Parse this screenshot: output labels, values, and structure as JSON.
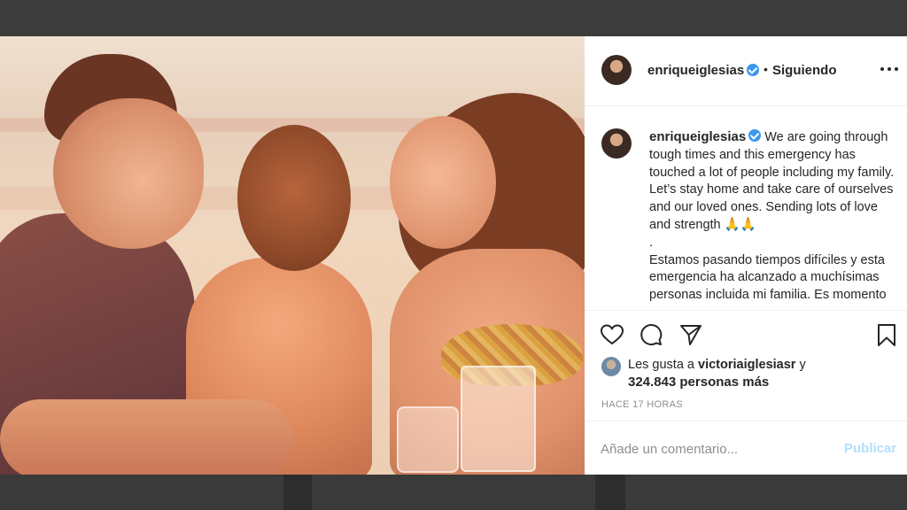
{
  "post": {
    "username": "enriqueiglesias",
    "follow_status": "Siguiendo",
    "separator": "•",
    "caption": {
      "line_en": "We are going through tough times and this emergency has touched a lot of people including my family. Let’s stay home and take care of ourselves and our loved ones. Sending lots of love and strength",
      "emoji": "🙏🙏",
      "dot": ".",
      "line_es": "Estamos pasando tiempos difíciles y esta emergencia ha alcanzado a muchísimas personas incluida mi familia. Es momento"
    },
    "likes": {
      "prefix": "Les gusta a",
      "user": "victoriaiglesiasr",
      "connector": "y",
      "others": "324.843 personas más"
    },
    "timestamp": "HACE 17 HORAS",
    "comment": {
      "placeholder": "Añade un comentario...",
      "publish_label": "Publicar"
    }
  },
  "icons": {
    "more": "more-options-icon",
    "like": "heart-icon",
    "comment": "comment-icon",
    "share": "send-icon",
    "save": "bookmark-icon",
    "verified": "verified-badge-icon"
  },
  "colors": {
    "verified": "#3897f0",
    "publish_disabled": "#b2dffc",
    "muted_text": "#8e8e8e"
  }
}
